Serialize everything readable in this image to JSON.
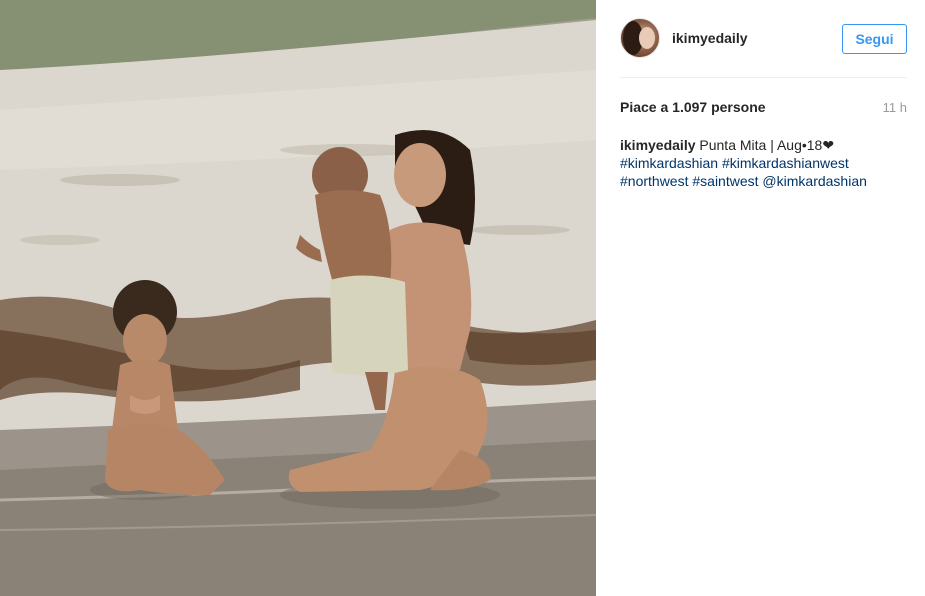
{
  "post": {
    "image_description_icon": "beach-photo",
    "username": "ikimyedaily",
    "follow_label": "Segui",
    "likes": "Piace a 1.097 persone",
    "time": "11 h",
    "caption": {
      "username": "ikimyedaily",
      "text": "Punta Mita | Aug•18❤",
      "tags": [
        "#kimkardashian",
        "#kimkardashianwest",
        "#northwest",
        "#saintwest",
        "@kimkardashian"
      ]
    }
  },
  "colors": {
    "follow_blue": "#3897f0",
    "link_blue": "#003569",
    "time_gray": "#999999",
    "divider": "#efefef"
  }
}
